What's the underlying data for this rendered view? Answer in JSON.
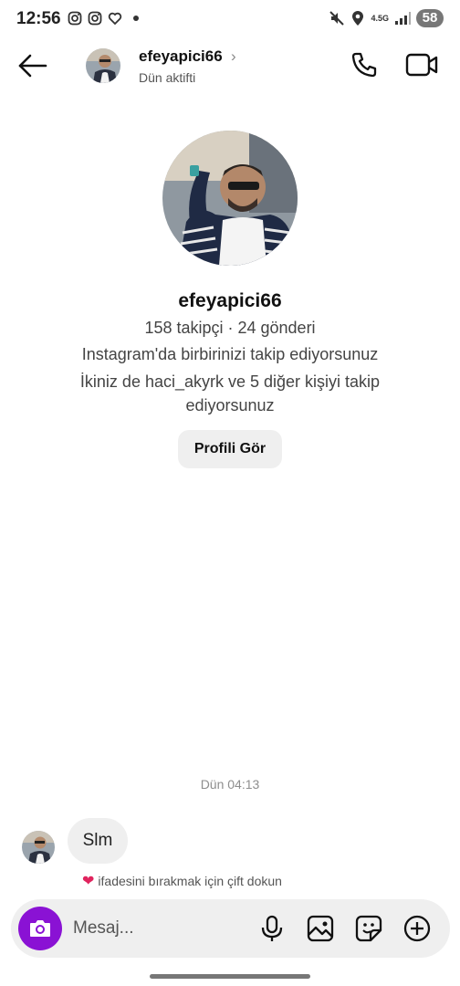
{
  "status_bar": {
    "time": "12:56",
    "network": "4.5G",
    "battery": "58",
    "icons": [
      "instagram-icon",
      "instagram-icon",
      "heart-notification-icon",
      "mute-icon",
      "location-icon",
      "signal-icon"
    ]
  },
  "header": {
    "username": "efeyapici66",
    "activity": "Dün aktifti",
    "chevron": "›"
  },
  "profile": {
    "name": "efeyapici66",
    "stats": "158 takipçi · 24 gönderi",
    "follow_status": "Instagram'da birbirinizi takip ediyorsunuz",
    "mutual": "İkiniz de haci_akyrk ve 5 diğer kişiyi takip ediyorsunuz",
    "button_label": "Profili Gör"
  },
  "conversation": {
    "timestamp": "Dün 04:13",
    "messages": [
      {
        "sender": "efeyapici66",
        "text": "Slm"
      }
    ],
    "reaction_hint": "ifadesini bırakmak için çift dokun",
    "reaction_emoji": "❤"
  },
  "composer": {
    "placeholder": "Mesaj..."
  },
  "colors": {
    "accent": "#8a12d4",
    "bubble": "#efefef",
    "heart": "#e0245e"
  }
}
